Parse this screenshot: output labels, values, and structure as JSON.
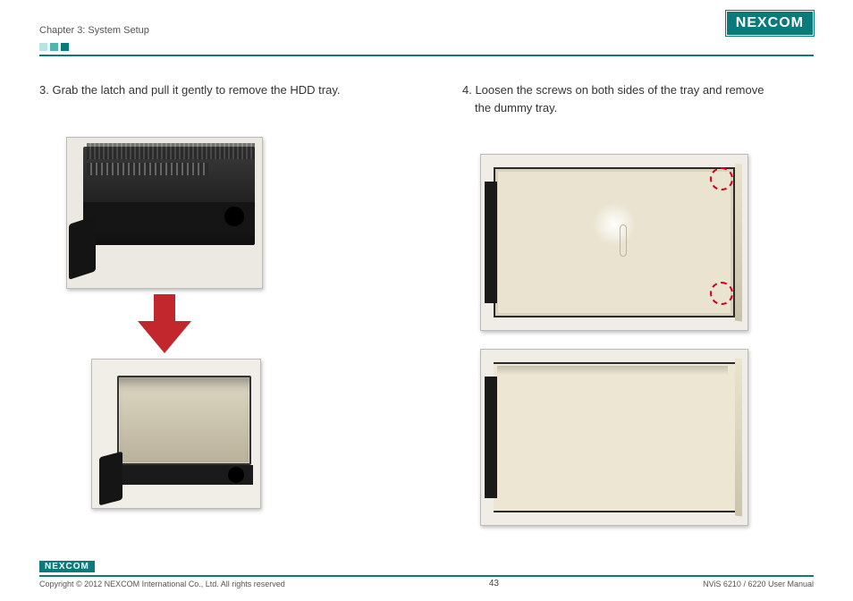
{
  "header": {
    "chapter": "Chapter 3: System Setup",
    "brand": "NEXCOM"
  },
  "steps": {
    "s3": "3. Grab the latch and pull it gently to remove the HDD tray.",
    "s4a": "4. Loosen the screws on both sides of the tray and remove",
    "s4b": "the dummy tray."
  },
  "footer": {
    "brand": "NEXCOM",
    "copyright": "Copyright © 2012 NEXCOM International Co., Ltd. All rights reserved",
    "page": "43",
    "docref": "NViS 6210 / 6220 User Manual"
  }
}
